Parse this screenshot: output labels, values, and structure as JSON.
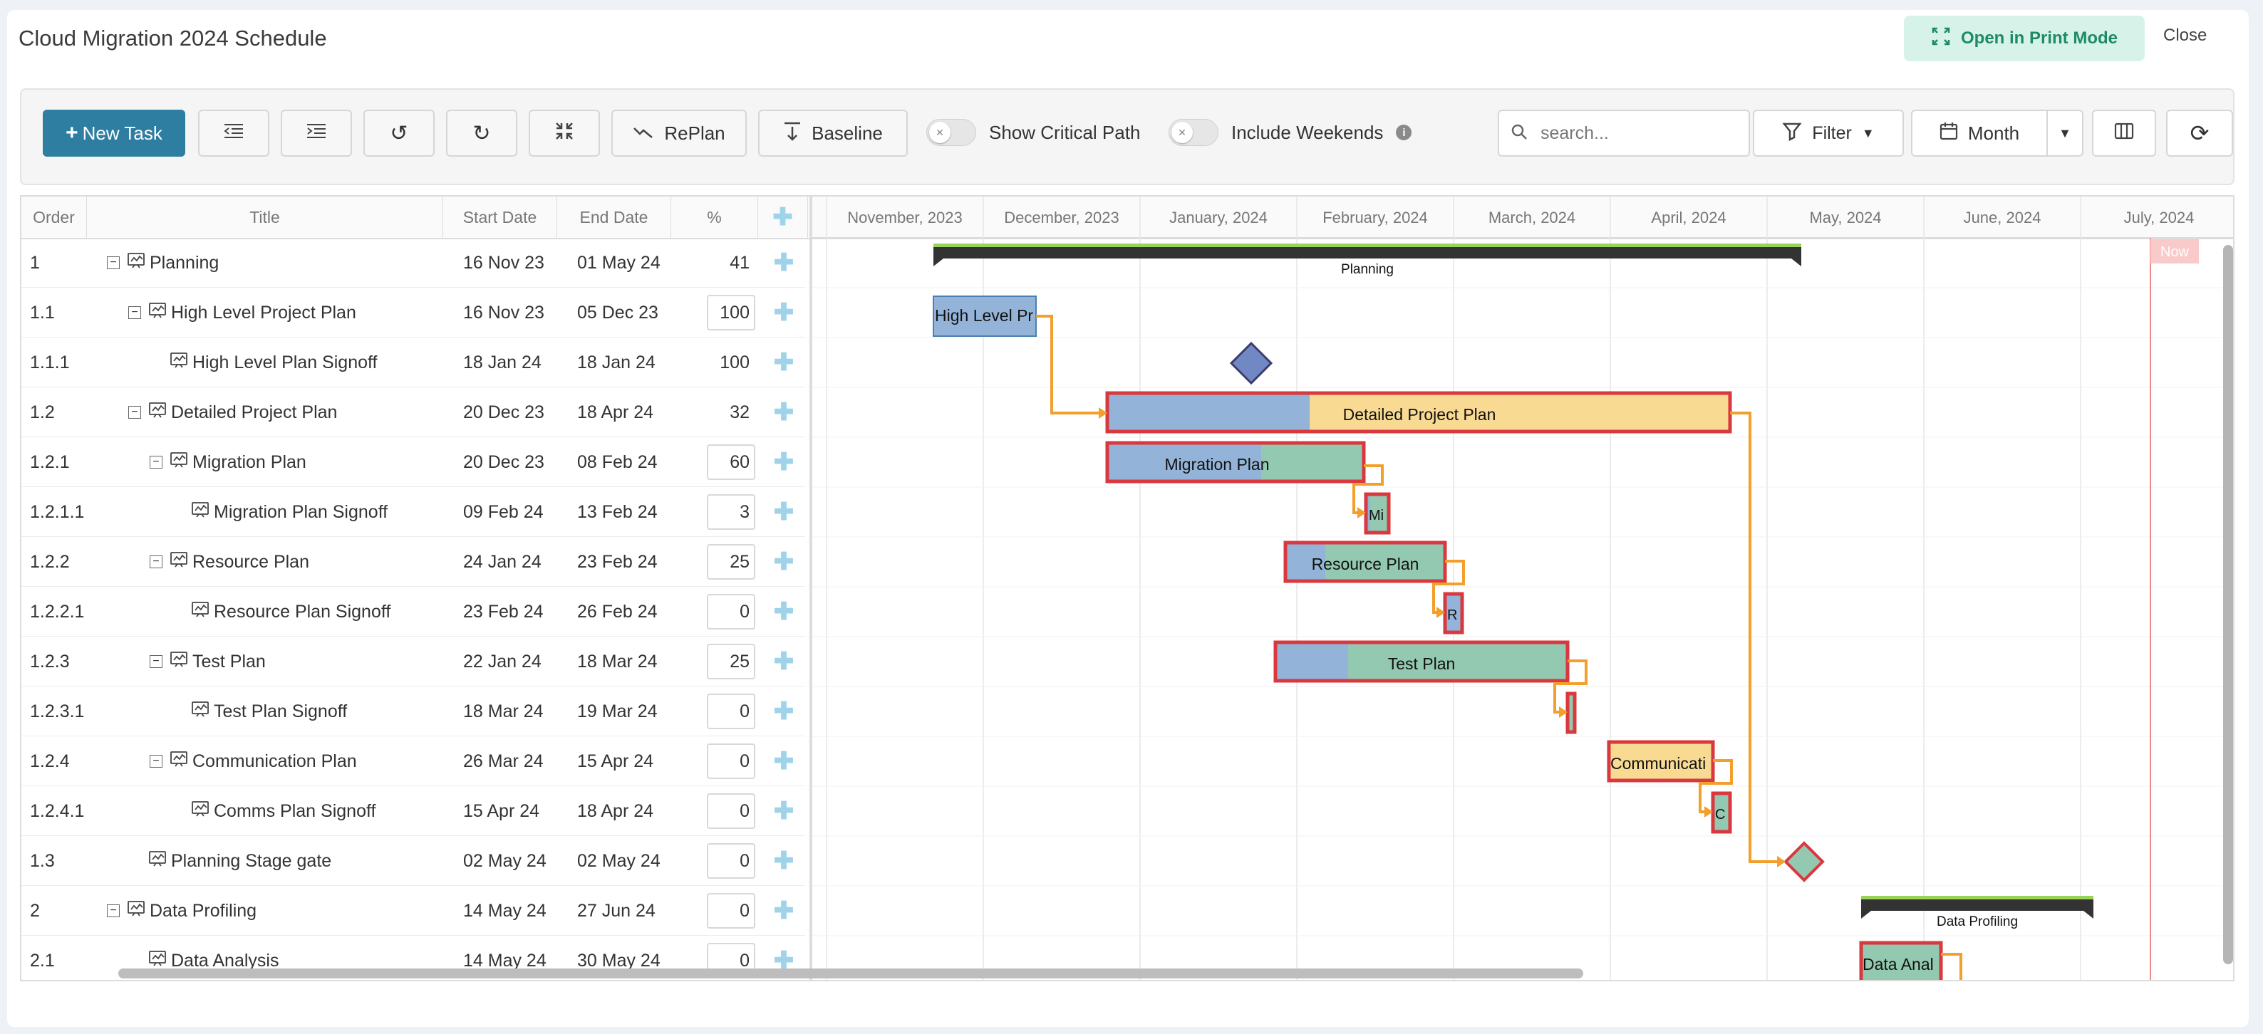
{
  "app": {
    "title": "Cloud Migration 2024 Schedule"
  },
  "header_actions": {
    "print_label": "Open in Print Mode",
    "close_label": "Close"
  },
  "toolbar": {
    "new_task_label": "New Task",
    "replan_label": "RePlan",
    "baseline_label": "Baseline",
    "critical_path_label": "Show Critical Path",
    "include_weekends_label": "Include Weekends",
    "search_placeholder": "search...",
    "filter_label": "Filter",
    "zoom_label": "Month"
  },
  "columns": [
    "Order",
    "Title",
    "Start Date",
    "End Date",
    "%"
  ],
  "timeline_months": [
    "November, 2023",
    "December, 2023",
    "January, 2024",
    "February, 2024",
    "March, 2024",
    "April, 2024",
    "May, 2024",
    "June, 2024",
    "July, 2024"
  ],
  "now_label": "Now",
  "tasks": [
    {
      "order": "1",
      "title": "Planning",
      "start": "16 Nov 23",
      "end": "01 May 24",
      "pct": "41",
      "level": 0,
      "expander": true,
      "pct_box": false
    },
    {
      "order": "1.1",
      "title": "High Level Project Plan",
      "start": "16 Nov 23",
      "end": "05 Dec 23",
      "pct": "100",
      "level": 1,
      "expander": true,
      "pct_box": true
    },
    {
      "order": "1.1.1",
      "title": "High Level Plan Signoff",
      "start": "18 Jan 24",
      "end": "18 Jan 24",
      "pct": "100",
      "level": 2,
      "expander": false,
      "pct_box": false
    },
    {
      "order": "1.2",
      "title": "Detailed Project Plan",
      "start": "20 Dec 23",
      "end": "18 Apr 24",
      "pct": "32",
      "level": 1,
      "expander": true,
      "pct_box": false
    },
    {
      "order": "1.2.1",
      "title": "Migration Plan",
      "start": "20 Dec 23",
      "end": "08 Feb 24",
      "pct": "60",
      "level": 2,
      "expander": true,
      "pct_box": true
    },
    {
      "order": "1.2.1.1",
      "title": "Migration Plan Signoff",
      "start": "09 Feb 24",
      "end": "13 Feb 24",
      "pct": "3",
      "level": 3,
      "expander": false,
      "pct_box": true
    },
    {
      "order": "1.2.2",
      "title": "Resource Plan",
      "start": "24 Jan 24",
      "end": "23 Feb 24",
      "pct": "25",
      "level": 2,
      "expander": true,
      "pct_box": true
    },
    {
      "order": "1.2.2.1",
      "title": "Resource Plan Signoff",
      "start": "23 Feb 24",
      "end": "26 Feb 24",
      "pct": "0",
      "level": 3,
      "expander": false,
      "pct_box": true
    },
    {
      "order": "1.2.3",
      "title": "Test Plan",
      "start": "22 Jan 24",
      "end": "18 Mar 24",
      "pct": "25",
      "level": 2,
      "expander": true,
      "pct_box": true
    },
    {
      "order": "1.2.3.1",
      "title": "Test Plan Signoff",
      "start": "18 Mar 24",
      "end": "19 Mar 24",
      "pct": "0",
      "level": 3,
      "expander": false,
      "pct_box": true
    },
    {
      "order": "1.2.4",
      "title": "Communication Plan",
      "start": "26 Mar 24",
      "end": "15 Apr 24",
      "pct": "0",
      "level": 2,
      "expander": true,
      "pct_box": true
    },
    {
      "order": "1.2.4.1",
      "title": "Comms Plan Signoff",
      "start": "15 Apr 24",
      "end": "18 Apr 24",
      "pct": "0",
      "level": 3,
      "expander": false,
      "pct_box": true
    },
    {
      "order": "1.3",
      "title": "Planning Stage gate",
      "start": "02 May 24",
      "end": "02 May 24",
      "pct": "0",
      "level": 1,
      "expander": false,
      "pct_box": true
    },
    {
      "order": "2",
      "title": "Data Profiling",
      "start": "14 May 24",
      "end": "27 Jun 24",
      "pct": "0",
      "level": 0,
      "expander": true,
      "pct_box": true
    },
    {
      "order": "2.1",
      "title": "Data Analysis",
      "start": "14 May 24",
      "end": "30 May 24",
      "pct": "0",
      "level": 1,
      "expander": false,
      "pct_box": true
    }
  ],
  "bar_labels": {
    "planning": "Planning",
    "high_level": "High Level Pr",
    "detailed": "Detailed Project Plan",
    "migration": "Migration Plan",
    "migration_signoff": "Mi",
    "resource": "Resource Plan",
    "resource_signoff": "R",
    "test": "Test Plan",
    "communication": "Communicati",
    "comms_signoff": "C",
    "data_profiling": "Data Profiling",
    "data_analysis": "Data Anal"
  },
  "colors": {
    "accent": "#2e7ea2",
    "critical_border": "#d9383e",
    "progress_blue": "#93b4d8",
    "bar_yellow": "#f8da93",
    "bar_green": "#93c9b0",
    "link": "#f29f2c",
    "now_line": "#f08a8a"
  }
}
